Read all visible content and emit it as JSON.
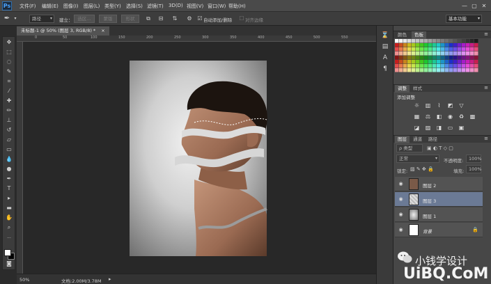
{
  "app": {
    "logo": "Ps"
  },
  "menubar": {
    "items": [
      "文件(F)",
      "编辑(E)",
      "图像(I)",
      "图层(L)",
      "类型(Y)",
      "选择(S)",
      "滤镜(T)",
      "3D(D)",
      "视图(V)",
      "窗口(W)",
      "帮助(H)"
    ],
    "window_controls": [
      "—",
      "▢",
      "✕"
    ]
  },
  "optionsbar": {
    "path_mode": "路径",
    "make_label": "建立：",
    "make_buttons": [
      "选区...",
      "蒙版",
      "形状"
    ],
    "auto_add_delete": "自动添加/删除",
    "align_edges": "对齐边缘",
    "workspace": "基本功能"
  },
  "document": {
    "tab_title": "未标题-1 @ 50% (图层 3, RGB/8) *",
    "zoom": "50%",
    "doc_size": "文档:2.00M/3.78M",
    "ruler_ticks": [
      "0",
      "50",
      "100",
      "150",
      "200",
      "250",
      "300",
      "350",
      "400",
      "450",
      "500",
      "550"
    ]
  },
  "panels": {
    "swatches_tabs": [
      "颜色",
      "色板"
    ],
    "adjust_tabs": [
      "调整",
      "样式"
    ],
    "adjust_title": "添加调整",
    "layers_tabs": [
      "图层",
      "通道",
      "路径"
    ],
    "kind_filter": "ρ 类型",
    "blend_mode": "正常",
    "opacity_label": "不透明度:",
    "opacity_value": "100%",
    "lock_label": "锁定:",
    "fill_label": "填充:",
    "fill_value": "100%",
    "layers": [
      {
        "name": "图层 2",
        "selected": false
      },
      {
        "name": "图层 3",
        "selected": true
      },
      {
        "name": "图层 1",
        "selected": false
      },
      {
        "name": "背景",
        "selected": false
      }
    ]
  },
  "watermark": {
    "text": "小钱学设计",
    "brand": "UiBQ.CoM"
  }
}
